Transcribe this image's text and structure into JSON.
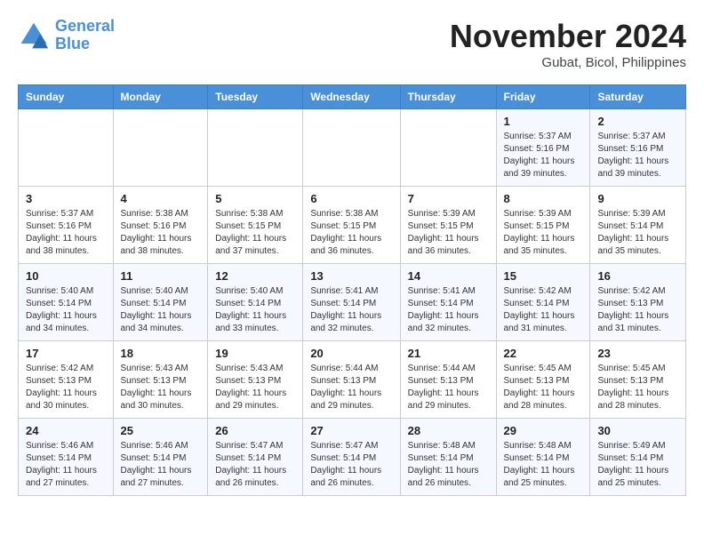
{
  "logo": {
    "line1": "General",
    "line2": "Blue"
  },
  "title": "November 2024",
  "location": "Gubat, Bicol, Philippines",
  "weekdays": [
    "Sunday",
    "Monday",
    "Tuesday",
    "Wednesday",
    "Thursday",
    "Friday",
    "Saturday"
  ],
  "weeks": [
    [
      {
        "day": "",
        "info": ""
      },
      {
        "day": "",
        "info": ""
      },
      {
        "day": "",
        "info": ""
      },
      {
        "day": "",
        "info": ""
      },
      {
        "day": "",
        "info": ""
      },
      {
        "day": "1",
        "info": "Sunrise: 5:37 AM\nSunset: 5:16 PM\nDaylight: 11 hours and 39 minutes."
      },
      {
        "day": "2",
        "info": "Sunrise: 5:37 AM\nSunset: 5:16 PM\nDaylight: 11 hours and 39 minutes."
      }
    ],
    [
      {
        "day": "3",
        "info": "Sunrise: 5:37 AM\nSunset: 5:16 PM\nDaylight: 11 hours and 38 minutes."
      },
      {
        "day": "4",
        "info": "Sunrise: 5:38 AM\nSunset: 5:16 PM\nDaylight: 11 hours and 38 minutes."
      },
      {
        "day": "5",
        "info": "Sunrise: 5:38 AM\nSunset: 5:15 PM\nDaylight: 11 hours and 37 minutes."
      },
      {
        "day": "6",
        "info": "Sunrise: 5:38 AM\nSunset: 5:15 PM\nDaylight: 11 hours and 36 minutes."
      },
      {
        "day": "7",
        "info": "Sunrise: 5:39 AM\nSunset: 5:15 PM\nDaylight: 11 hours and 36 minutes."
      },
      {
        "day": "8",
        "info": "Sunrise: 5:39 AM\nSunset: 5:15 PM\nDaylight: 11 hours and 35 minutes."
      },
      {
        "day": "9",
        "info": "Sunrise: 5:39 AM\nSunset: 5:14 PM\nDaylight: 11 hours and 35 minutes."
      }
    ],
    [
      {
        "day": "10",
        "info": "Sunrise: 5:40 AM\nSunset: 5:14 PM\nDaylight: 11 hours and 34 minutes."
      },
      {
        "day": "11",
        "info": "Sunrise: 5:40 AM\nSunset: 5:14 PM\nDaylight: 11 hours and 34 minutes."
      },
      {
        "day": "12",
        "info": "Sunrise: 5:40 AM\nSunset: 5:14 PM\nDaylight: 11 hours and 33 minutes."
      },
      {
        "day": "13",
        "info": "Sunrise: 5:41 AM\nSunset: 5:14 PM\nDaylight: 11 hours and 32 minutes."
      },
      {
        "day": "14",
        "info": "Sunrise: 5:41 AM\nSunset: 5:14 PM\nDaylight: 11 hours and 32 minutes."
      },
      {
        "day": "15",
        "info": "Sunrise: 5:42 AM\nSunset: 5:14 PM\nDaylight: 11 hours and 31 minutes."
      },
      {
        "day": "16",
        "info": "Sunrise: 5:42 AM\nSunset: 5:13 PM\nDaylight: 11 hours and 31 minutes."
      }
    ],
    [
      {
        "day": "17",
        "info": "Sunrise: 5:42 AM\nSunset: 5:13 PM\nDaylight: 11 hours and 30 minutes."
      },
      {
        "day": "18",
        "info": "Sunrise: 5:43 AM\nSunset: 5:13 PM\nDaylight: 11 hours and 30 minutes."
      },
      {
        "day": "19",
        "info": "Sunrise: 5:43 AM\nSunset: 5:13 PM\nDaylight: 11 hours and 29 minutes."
      },
      {
        "day": "20",
        "info": "Sunrise: 5:44 AM\nSunset: 5:13 PM\nDaylight: 11 hours and 29 minutes."
      },
      {
        "day": "21",
        "info": "Sunrise: 5:44 AM\nSunset: 5:13 PM\nDaylight: 11 hours and 29 minutes."
      },
      {
        "day": "22",
        "info": "Sunrise: 5:45 AM\nSunset: 5:13 PM\nDaylight: 11 hours and 28 minutes."
      },
      {
        "day": "23",
        "info": "Sunrise: 5:45 AM\nSunset: 5:13 PM\nDaylight: 11 hours and 28 minutes."
      }
    ],
    [
      {
        "day": "24",
        "info": "Sunrise: 5:46 AM\nSunset: 5:14 PM\nDaylight: 11 hours and 27 minutes."
      },
      {
        "day": "25",
        "info": "Sunrise: 5:46 AM\nSunset: 5:14 PM\nDaylight: 11 hours and 27 minutes."
      },
      {
        "day": "26",
        "info": "Sunrise: 5:47 AM\nSunset: 5:14 PM\nDaylight: 11 hours and 26 minutes."
      },
      {
        "day": "27",
        "info": "Sunrise: 5:47 AM\nSunset: 5:14 PM\nDaylight: 11 hours and 26 minutes."
      },
      {
        "day": "28",
        "info": "Sunrise: 5:48 AM\nSunset: 5:14 PM\nDaylight: 11 hours and 26 minutes."
      },
      {
        "day": "29",
        "info": "Sunrise: 5:48 AM\nSunset: 5:14 PM\nDaylight: 11 hours and 25 minutes."
      },
      {
        "day": "30",
        "info": "Sunrise: 5:49 AM\nSunset: 5:14 PM\nDaylight: 11 hours and 25 minutes."
      }
    ]
  ]
}
